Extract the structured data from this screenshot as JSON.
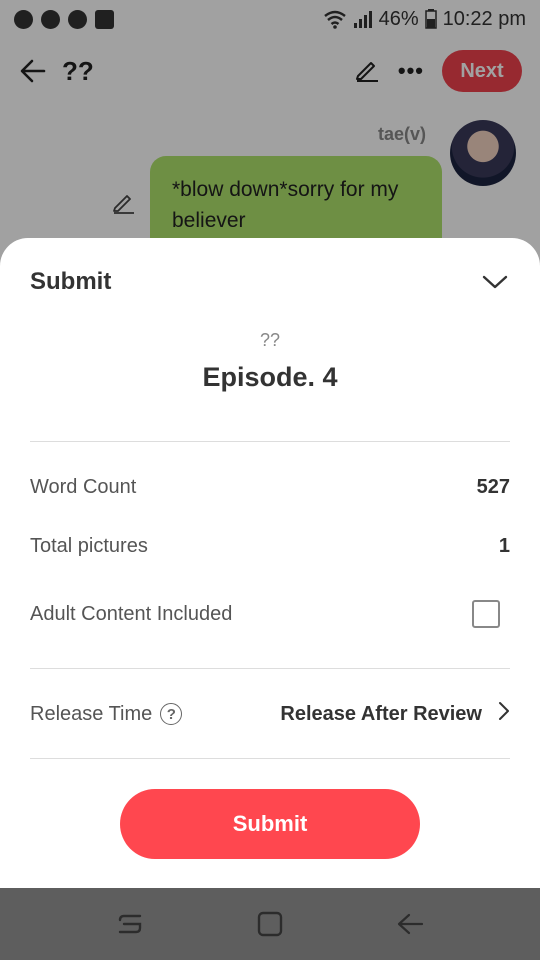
{
  "status_bar": {
    "battery": "46%",
    "time": "10:22 pm",
    "icons": [
      "messenger-icon",
      "chat-icon",
      "chat-icon",
      "image-icon",
      "wifi-icon",
      "signal-icon",
      "battery-icon"
    ]
  },
  "top_bar": {
    "title": "??",
    "next_label": "Next",
    "icons": [
      "back-arrow-icon",
      "edit-icon",
      "more-icon"
    ]
  },
  "chat": {
    "author": "tae(v)",
    "message": "*blow down*sorry for my believer"
  },
  "sheet": {
    "title": "Submit",
    "story_name": "??",
    "episode_title": "Episode. 4",
    "word_count_label": "Word Count",
    "word_count_value": "527",
    "pictures_label": "Total pictures",
    "pictures_value": "1",
    "adult_label": "Adult Content Included",
    "adult_checked": false,
    "release_label": "Release Time",
    "help_glyph": "?",
    "release_value": "Release After Review",
    "submit_label": "Submit"
  },
  "colors": {
    "accent": "#ff474f",
    "bubble": "#aee36c",
    "nav_bg": "#5e5e5e"
  }
}
